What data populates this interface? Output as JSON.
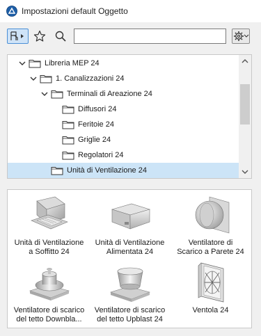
{
  "window": {
    "title": "Impostazioni default Oggetto"
  },
  "toolbar": {
    "mode_icon": "object-library-icon",
    "favorites_icon": "star-icon",
    "search_icon": "magnifier-icon",
    "search_value": "",
    "settings_icon": "gear-dropdown-icon"
  },
  "tree": {
    "items": [
      {
        "label": "Libreria MEP 24",
        "level": 0,
        "expanded": true,
        "selected": false
      },
      {
        "label": "1. Canalizzazioni 24",
        "level": 1,
        "expanded": true,
        "selected": false
      },
      {
        "label": "Terminali di Areazione 24",
        "level": 2,
        "expanded": true,
        "selected": false
      },
      {
        "label": "Diffusori 24",
        "level": 3,
        "expanded": false,
        "selected": false
      },
      {
        "label": "Feritoie 24",
        "level": 3,
        "expanded": false,
        "selected": false
      },
      {
        "label": "Griglie 24",
        "level": 3,
        "expanded": false,
        "selected": false
      },
      {
        "label": "Regolatori 24",
        "level": 3,
        "expanded": false,
        "selected": false
      },
      {
        "label": "Unità di Ventilazione 24",
        "level": 2,
        "expanded": false,
        "selected": true
      }
    ]
  },
  "grid": {
    "items": [
      {
        "label": "Unità di Ventilazione\na Soffitto 24",
        "icon": "ceiling-unit-icon"
      },
      {
        "label": "Unità di Ventilazione\nAlimentata 24",
        "icon": "box-unit-icon"
      },
      {
        "label": "Ventilatore di\nScarico a Parete 24",
        "icon": "wall-fan-icon"
      },
      {
        "label": "Ventilatore di scarico\ndel tetto Downbla...",
        "icon": "roof-fan-downblast-icon"
      },
      {
        "label": "Ventilatore di scarico\ndel tetto Upblast 24",
        "icon": "roof-fan-upblast-icon"
      },
      {
        "label": "Ventola 24",
        "icon": "fan-grille-icon"
      }
    ]
  },
  "colors": {
    "selection": "#cce4f7",
    "accent": "#4a8fd6",
    "panel_bg": "#f0f0f0"
  }
}
